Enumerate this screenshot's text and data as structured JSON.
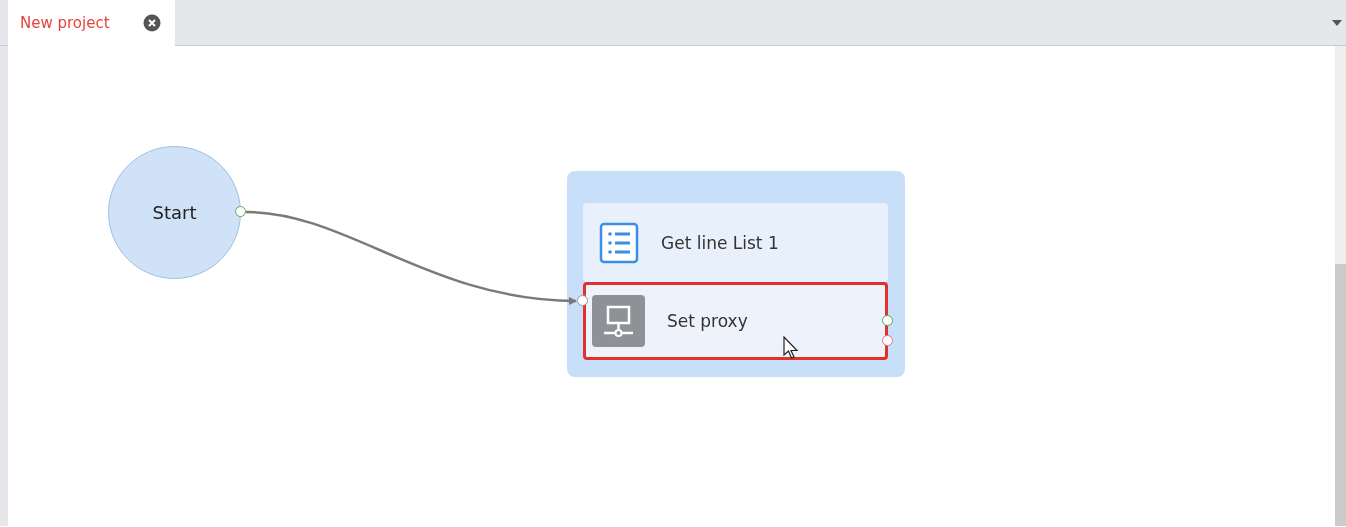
{
  "tabs": [
    {
      "label": "New project",
      "selected": true
    }
  ],
  "canvas": {
    "start": {
      "label": "Start"
    },
    "group": {
      "actions": [
        {
          "kind": "list",
          "label": "Get line List 1",
          "selected": false
        },
        {
          "kind": "proxy",
          "label": "Set proxy",
          "selected": true
        }
      ]
    }
  }
}
